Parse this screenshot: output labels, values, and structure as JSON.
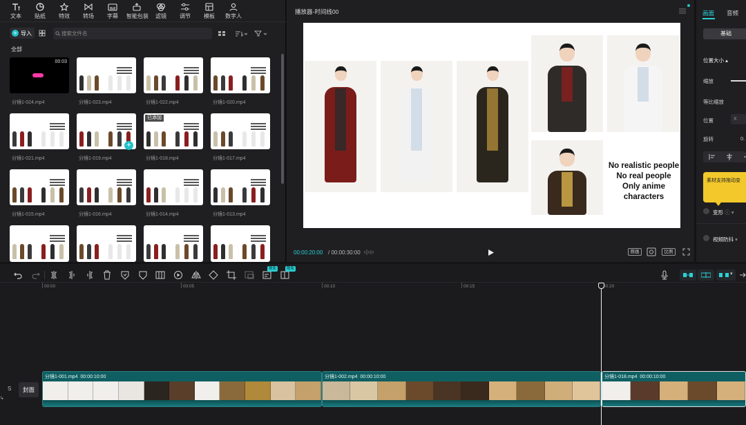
{
  "toolbar": {
    "items": [
      {
        "label": "文本",
        "icon": "text-icon"
      },
      {
        "label": "贴纸",
        "icon": "sticker-icon"
      },
      {
        "label": "特效",
        "icon": "effects-icon"
      },
      {
        "label": "转场",
        "icon": "transition-icon"
      },
      {
        "label": "字幕",
        "icon": "subtitle-icon"
      },
      {
        "label": "智能包装",
        "icon": "smart-pack-icon"
      },
      {
        "label": "滤镜",
        "icon": "filter-icon"
      },
      {
        "label": "调节",
        "icon": "adjust-icon"
      },
      {
        "label": "模板",
        "icon": "template-icon"
      },
      {
        "label": "数字人",
        "icon": "digital-human-icon"
      }
    ]
  },
  "media": {
    "import_label": "导入",
    "search_placeholder": "搜索文件名",
    "all_label": "全部",
    "first_duration": "00:03",
    "added_badge": "已添加",
    "items": [
      "分镜1-024.mp4",
      "分镜1-023.mp4",
      "分镜1-022.mp4",
      "分镜1-020.mp4",
      "分镜1-021.mp4",
      "分镜1-019.mp4",
      "分镜1-018.mp4",
      "分镜1-017.mp4",
      "分镜1-015.mp4",
      "分镜1-016.mp4",
      "分镜1-014.mp4",
      "分镜1-013.mp4",
      "",
      "",
      "",
      ""
    ]
  },
  "player": {
    "title": "播放器-时间线00",
    "canvas_text": [
      "No realistic people",
      "No real people",
      "Only anime characters"
    ],
    "time_current": "00:00:20:00",
    "time_total": "/ 00:00:30:00",
    "btn_original": "原画",
    "btn_ratio": "比例"
  },
  "inspector": {
    "tab_picture": "画面",
    "tab_audio": "音频",
    "basic_button": "基础",
    "section_position_size": "位置大小",
    "scale_label": "缩放",
    "uniform_scale_label": "等比缩放",
    "position_label": "位置",
    "position_x": "X",
    "rotate_label": "旋转",
    "rotate_value": "0.",
    "tooltip": "素材支持拖动变",
    "deform_label": "变形",
    "stabilize_label": "视频防抖"
  },
  "timeline": {
    "badge_1": "限免",
    "badge_2": "限免",
    "ruler": [
      "00:00",
      "00:05",
      "00:10",
      "00:15",
      "00:20"
    ],
    "cover_label": "封面",
    "track_s": "S",
    "clips": [
      {
        "name": "分镜1-001.mp4",
        "duration": "00:00:10:00"
      },
      {
        "name": "分镜1-002.mp4",
        "duration": "00:00:10:00"
      },
      {
        "name": "分镜1-018.mp4",
        "duration": "00:00:10:00"
      }
    ]
  },
  "colors": {
    "accent": "#22c3c9",
    "clip": "#0f5f62",
    "panel": "#1f1f22"
  }
}
